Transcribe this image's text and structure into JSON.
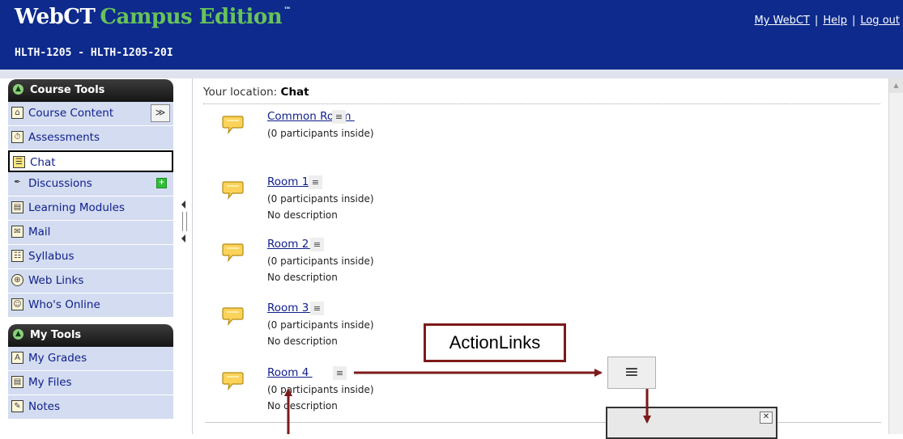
{
  "header": {
    "brand_main": "WebCT",
    "brand_edition": "Campus Edition",
    "trademark": "™",
    "course_code": "HLTH-1205 - HLTH-1205-20I",
    "links": [
      "My WebCT",
      "Help",
      "Log out"
    ],
    "link_separator": "|"
  },
  "nav": {
    "course_tools_title": "Course Tools",
    "course_tools": [
      {
        "label": "Course Content",
        "icon": "house-icon"
      },
      {
        "label": "Assessments",
        "icon": "stopwatch-icon"
      },
      {
        "label": "Chat",
        "icon": "chat-bubble-icon",
        "active": true
      },
      {
        "label": "Discussions",
        "icon": "pin-icon"
      },
      {
        "label": "Learning Modules",
        "icon": "modules-icon"
      },
      {
        "label": "Mail",
        "icon": "envelope-icon"
      },
      {
        "label": "Syllabus",
        "icon": "syllabus-icon"
      },
      {
        "label": "Web Links",
        "icon": "globe-icon"
      },
      {
        "label": "Who's Online",
        "icon": "person-icon"
      }
    ],
    "my_tools_title": "My Tools",
    "my_tools": [
      {
        "label": "My Grades",
        "icon": "grades-icon"
      },
      {
        "label": "My Files",
        "icon": "files-icon"
      },
      {
        "label": "Notes",
        "icon": "notes-icon"
      }
    ]
  },
  "main": {
    "location_label": "Your location:",
    "location_value": "Chat",
    "rooms": [
      {
        "name": "Common Room ",
        "participants": "(0 participants inside)",
        "description": ""
      },
      {
        "name": "Room 1 ",
        "participants": "(0 participants inside)",
        "description": "No description"
      },
      {
        "name": "Room 2 ",
        "participants": "(0 participants inside)",
        "description": "No description"
      },
      {
        "name": "Room 3 ",
        "participants": "(0 participants inside)",
        "description": "No description"
      },
      {
        "name": "Room 4 ",
        "participants": "(0 participants inside)",
        "description": "No description"
      }
    ]
  },
  "annotation": {
    "callout_label": "ActionLinks"
  },
  "colors": {
    "header_bg": "#0d2a8c",
    "brand_green": "#68c35a",
    "nav_item_bg": "#d3dcf0",
    "link_blue": "#0e1e8a",
    "annotation_red": "#7d1a1a"
  }
}
